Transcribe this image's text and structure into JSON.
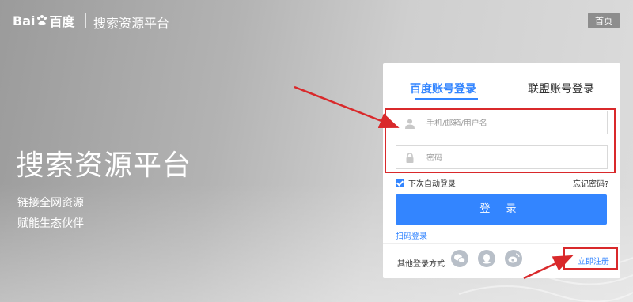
{
  "header": {
    "logo_text_left": "Bai",
    "logo_text_right": "百度",
    "title": "搜索资源平台",
    "home_label": "首页"
  },
  "hero": {
    "title": "搜索资源平台",
    "line1": "链接全网资源",
    "line2": "赋能生态伙伴"
  },
  "login": {
    "tab_active": "百度账号登录",
    "tab_inactive": "联盟账号登录",
    "username_placeholder": "手机/邮箱/用户名",
    "password_placeholder": "密码",
    "remember_label": "下次自动登录",
    "remember_checked": true,
    "forgot_label": "忘记密码?",
    "submit_label": "登 录",
    "qr_label": "扫码登录",
    "other_label": "其他登录方式",
    "social_icons": [
      "wechat-icon",
      "qq-icon",
      "weibo-icon"
    ],
    "register_label": "立即注册"
  },
  "colors": {
    "accent": "#3385ff",
    "annotation_red": "#d9292b"
  }
}
